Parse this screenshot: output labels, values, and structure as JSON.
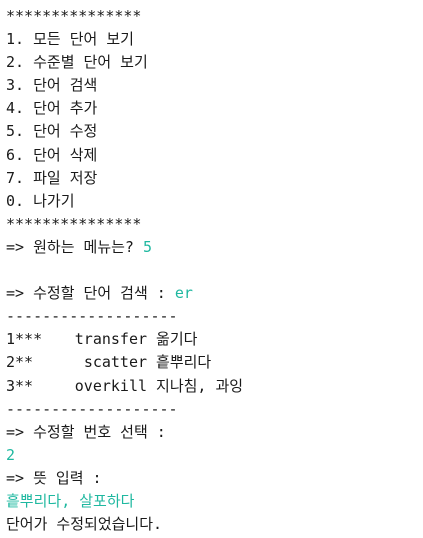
{
  "menu": {
    "border": "***************",
    "items": [
      "1. 모든 단어 보기",
      "2. 수준별 단어 보기",
      "3. 단어 검색",
      "4. 단어 추가",
      "5. 단어 수정",
      "6. 단어 삭제",
      "7. 파일 저장",
      "0. 나가기"
    ]
  },
  "prompts": {
    "menu_prompt": "=> 원하는 메뉴는? ",
    "menu_input": "5",
    "search_prompt": "=> 수정할 단어 검색 : ",
    "search_input": "er",
    "select_prompt": "=> 수정할 번호 선택 :",
    "select_input": "2",
    "meaning_prompt": "=> 뜻 입력 :",
    "meaning_input": "흩뿌리다, 살포하다",
    "result": "단어가 수정되었습니다."
  },
  "results": {
    "separator": "-------------------",
    "rows": [
      {
        "num": "1",
        "stars": "***",
        "word": "transfer",
        "meaning": "옮기다"
      },
      {
        "num": "2",
        "stars": "**",
        "word": "scatter",
        "meaning": "흩뿌리다"
      },
      {
        "num": "3",
        "stars": "**",
        "word": "overkill",
        "meaning": "지나침, 과잉"
      }
    ]
  },
  "colors": {
    "text": "#1a1a1a",
    "input": "#1fb8a0",
    "background": "#ffffff"
  }
}
